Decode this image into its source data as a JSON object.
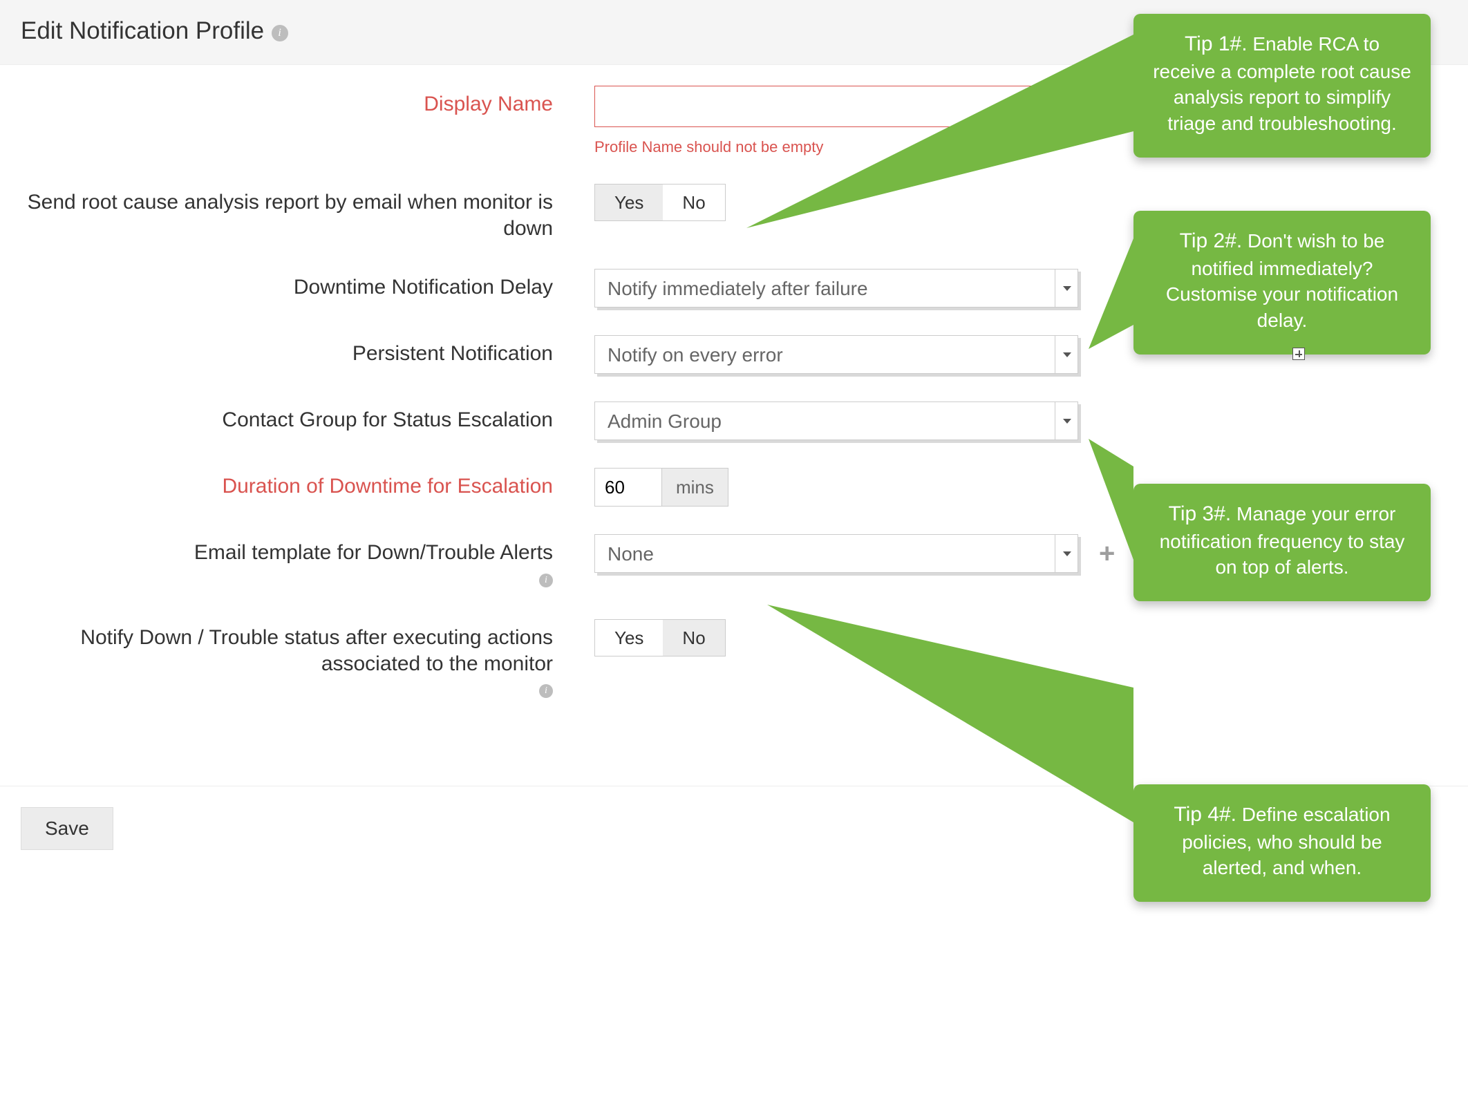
{
  "header": {
    "title": "Edit Notification Profile"
  },
  "form": {
    "display_name": {
      "label": "Display Name",
      "value": "",
      "error": "Profile Name should not be empty"
    },
    "rca_email": {
      "label": "Send root cause analysis report by email when monitor is down",
      "yes": "Yes",
      "no": "No",
      "selected": "yes"
    },
    "delay": {
      "label": "Downtime Notification Delay",
      "value": "Notify immediately after failure"
    },
    "persistent": {
      "label": "Persistent Notification",
      "value": "Notify on every error"
    },
    "contact_group": {
      "label": "Contact Group for Status Escalation",
      "value": "Admin Group"
    },
    "duration": {
      "label": "Duration of Downtime for Escalation",
      "value": "60",
      "unit": "mins"
    },
    "email_tpl": {
      "label": "Email template for Down/Trouble Alerts",
      "value": "None"
    },
    "notify_after": {
      "label": "Notify Down / Trouble status after executing actions associated to the monitor",
      "yes": "Yes",
      "no": "No",
      "selected": "no"
    }
  },
  "footer": {
    "save": "Save"
  },
  "tips": {
    "t1": {
      "title": "Tip 1#.",
      "body": "Enable RCA to receive a complete root cause analysis report to simplify triage and troubleshooting."
    },
    "t2": {
      "title": "Tip 2#.",
      "body": "Don't wish to be notified immediately? Customise your notification delay."
    },
    "t3": {
      "title": "Tip 3#.",
      "body": "Manage your error notification frequency to stay on top of alerts."
    },
    "t4": {
      "title": "Tip 4#.",
      "body": "Define escalation policies, who should be alerted, and when."
    }
  }
}
